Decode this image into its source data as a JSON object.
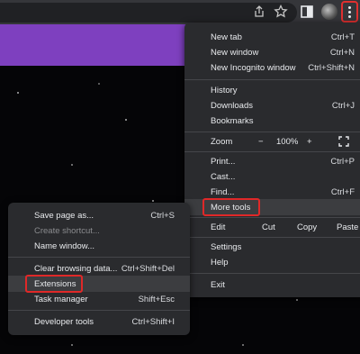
{
  "colors": {
    "accent_banner": "#7e40bf",
    "highlight_border": "#e02828",
    "menu_bg": "#2a2b2e"
  },
  "toolbar": {
    "icons": [
      "share-icon",
      "bookmark-star-icon",
      "side-panel-icon",
      "profile-avatar",
      "three-dot-menu-icon"
    ]
  },
  "main_menu": {
    "new_tab": {
      "label": "New tab",
      "shortcut": "Ctrl+T"
    },
    "new_window": {
      "label": "New window",
      "shortcut": "Ctrl+N"
    },
    "new_incognito": {
      "label": "New Incognito window",
      "shortcut": "Ctrl+Shift+N"
    },
    "history": {
      "label": "History"
    },
    "downloads": {
      "label": "Downloads",
      "shortcut": "Ctrl+J"
    },
    "bookmarks": {
      "label": "Bookmarks"
    },
    "zoom": {
      "label": "Zoom",
      "minus": "−",
      "value": "100%",
      "plus": "+"
    },
    "print": {
      "label": "Print...",
      "shortcut": "Ctrl+P"
    },
    "cast": {
      "label": "Cast..."
    },
    "find": {
      "label": "Find...",
      "shortcut": "Ctrl+F"
    },
    "more_tools": {
      "label": "More tools"
    },
    "edit": {
      "label": "Edit",
      "cut": "Cut",
      "copy": "Copy",
      "paste": "Paste"
    },
    "settings": {
      "label": "Settings"
    },
    "help": {
      "label": "Help"
    },
    "exit": {
      "label": "Exit"
    }
  },
  "sub_menu": {
    "save_page": {
      "label": "Save page as...",
      "shortcut": "Ctrl+S"
    },
    "create_shortcut": {
      "label": "Create shortcut..."
    },
    "name_window": {
      "label": "Name window..."
    },
    "clear_data": {
      "label": "Clear browsing data...",
      "shortcut": "Ctrl+Shift+Del"
    },
    "extensions": {
      "label": "Extensions"
    },
    "task_manager": {
      "label": "Task manager",
      "shortcut": "Shift+Esc"
    },
    "dev_tools": {
      "label": "Developer tools",
      "shortcut": "Ctrl+Shift+I"
    }
  }
}
